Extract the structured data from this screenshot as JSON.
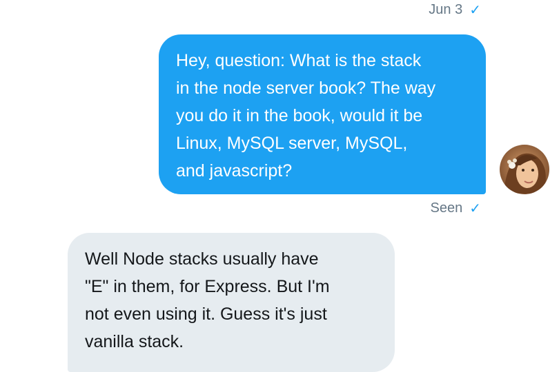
{
  "conversation": {
    "date_label": "Jun 3",
    "date_check_icon": "checkmark-icon",
    "messages": [
      {
        "direction": "outgoing",
        "text": "Hey, question: What is the stack\nin the node server book? The way\nyou do it in the book, would it be\nLinux, MySQL server, MySQL,\nand javascript?",
        "bubble_color": "#1da1f2",
        "text_color": "#ffffff"
      },
      {
        "direction": "incoming",
        "text": "Well Node stacks usually have\n\"E\" in them, for Express. But I'm\nnot even using it. Guess it's just\nvanilla stack.",
        "bubble_color": "#e6ecf0",
        "text_color": "#14171a"
      }
    ],
    "seen_label": "Seen",
    "seen_check_icon": "checkmark-icon",
    "avatar_icon": "user-avatar"
  },
  "colors": {
    "accent": "#1da1f2",
    "muted_text": "#657786",
    "incoming_bubble": "#e6ecf0"
  }
}
